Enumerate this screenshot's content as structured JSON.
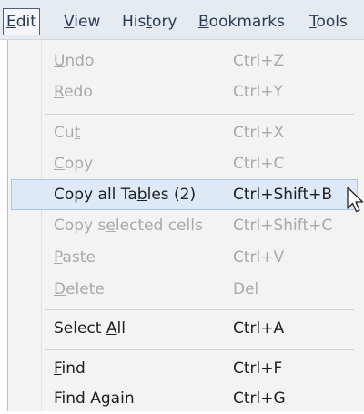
{
  "menubar": {
    "items": [
      {
        "pre": "",
        "key": "E",
        "post": "dit"
      },
      {
        "pre": "",
        "key": "V",
        "post": "iew"
      },
      {
        "pre": "His",
        "key": "t",
        "post": "ory"
      },
      {
        "pre": "",
        "key": "B",
        "post": "ookmarks"
      },
      {
        "pre": "",
        "key": "T",
        "post": "ools"
      }
    ]
  },
  "menu": {
    "items": [
      {
        "pre": "",
        "key": "U",
        "post": "ndo",
        "shortcut": "Ctrl+Z",
        "state": "disabled"
      },
      {
        "pre": "",
        "key": "R",
        "post": "edo",
        "shortcut": "Ctrl+Y",
        "state": "disabled"
      },
      {
        "pre": "Cu",
        "key": "t",
        "post": "",
        "shortcut": "Ctrl+X",
        "state": "disabled"
      },
      {
        "pre": "",
        "key": "C",
        "post": "opy",
        "shortcut": "Ctrl+C",
        "state": "disabled"
      },
      {
        "pre": "Copy all Ta",
        "key": "b",
        "post": "les (2)",
        "shortcut": "Ctrl+Shift+B",
        "state": "highlighted"
      },
      {
        "pre": "Copy s",
        "key": "e",
        "post": "lected cells",
        "shortcut": "Ctrl+Shift+C",
        "state": "disabled"
      },
      {
        "pre": "",
        "key": "P",
        "post": "aste",
        "shortcut": "Ctrl+V",
        "state": "disabled"
      },
      {
        "pre": "",
        "key": "D",
        "post": "elete",
        "shortcut": "Del",
        "state": "disabled"
      },
      {
        "pre": "Select ",
        "key": "A",
        "post": "ll",
        "shortcut": "Ctrl+A",
        "state": "enabled"
      },
      {
        "pre": "",
        "key": "F",
        "post": "ind",
        "shortcut": "Ctrl+F",
        "state": "enabled"
      },
      {
        "pre": "Find A",
        "key": "g",
        "post": "ain",
        "shortcut": "Ctrl+G",
        "state": "enabled"
      }
    ]
  },
  "colors": {
    "menubar_bg": "#e6ebf2",
    "menu_bg": "#f3f3f3",
    "highlight_bg": "#dde9f7",
    "highlight_border": "#a8c6ea",
    "disabled_text": "#a9a9a9",
    "enabled_text": "#1e1e1e"
  },
  "icons": [
    "mouse-cursor-icon"
  ]
}
